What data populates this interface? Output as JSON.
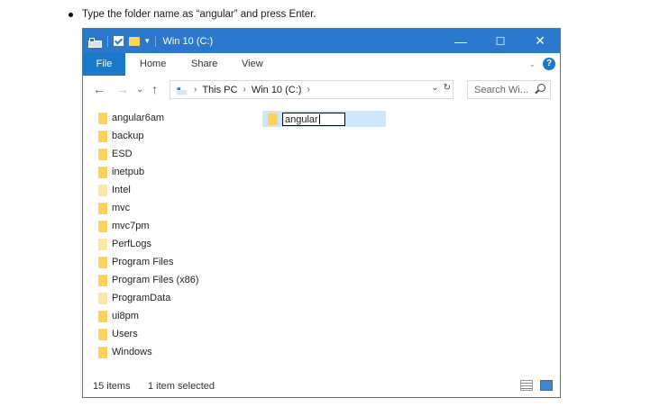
{
  "instruction": {
    "text": "Type the folder name as “angular” and press Enter."
  },
  "titlebar": {
    "title": "Win 10 (C:)",
    "qa_dropdown": "▾",
    "minimize": "—",
    "maximize": "☐",
    "close": "✕"
  },
  "ribbon": {
    "tabs": [
      "File",
      "Home",
      "Share",
      "View"
    ],
    "expand": "⌄",
    "help": "?"
  },
  "nav": {
    "back": "←",
    "forward": "→",
    "recent": "⌄",
    "up": "↑"
  },
  "address": {
    "segments": [
      "This PC",
      "Win 10 (C:)"
    ],
    "separator": "›",
    "dropdown": "⌄",
    "refresh": "↻"
  },
  "search": {
    "placeholder": "Search Wi..."
  },
  "folders": [
    {
      "name": "angular6am",
      "style": "normal"
    },
    {
      "name": "backup",
      "style": "normal"
    },
    {
      "name": "ESD",
      "style": "normal"
    },
    {
      "name": "inetpub",
      "style": "normal"
    },
    {
      "name": "Intel",
      "style": "light"
    },
    {
      "name": "mvc",
      "style": "normal"
    },
    {
      "name": "mvc7pm",
      "style": "normal"
    },
    {
      "name": "PerfLogs",
      "style": "light"
    },
    {
      "name": "Program Files",
      "style": "normal"
    },
    {
      "name": "Program Files (x86)",
      "style": "normal"
    },
    {
      "name": "ProgramData",
      "style": "light"
    },
    {
      "name": "ui8pm",
      "style": "normal"
    },
    {
      "name": "Users",
      "style": "normal"
    },
    {
      "name": "Windows",
      "style": "normal"
    }
  ],
  "new_folder": {
    "name_value": "angular"
  },
  "status": {
    "count": "15 items",
    "selected": "1 item selected"
  },
  "colors": {
    "titlebar": "#2b78cc",
    "file_tab": "#1979ca",
    "selection": "#cce8ff",
    "folder": "#ffd35a"
  }
}
